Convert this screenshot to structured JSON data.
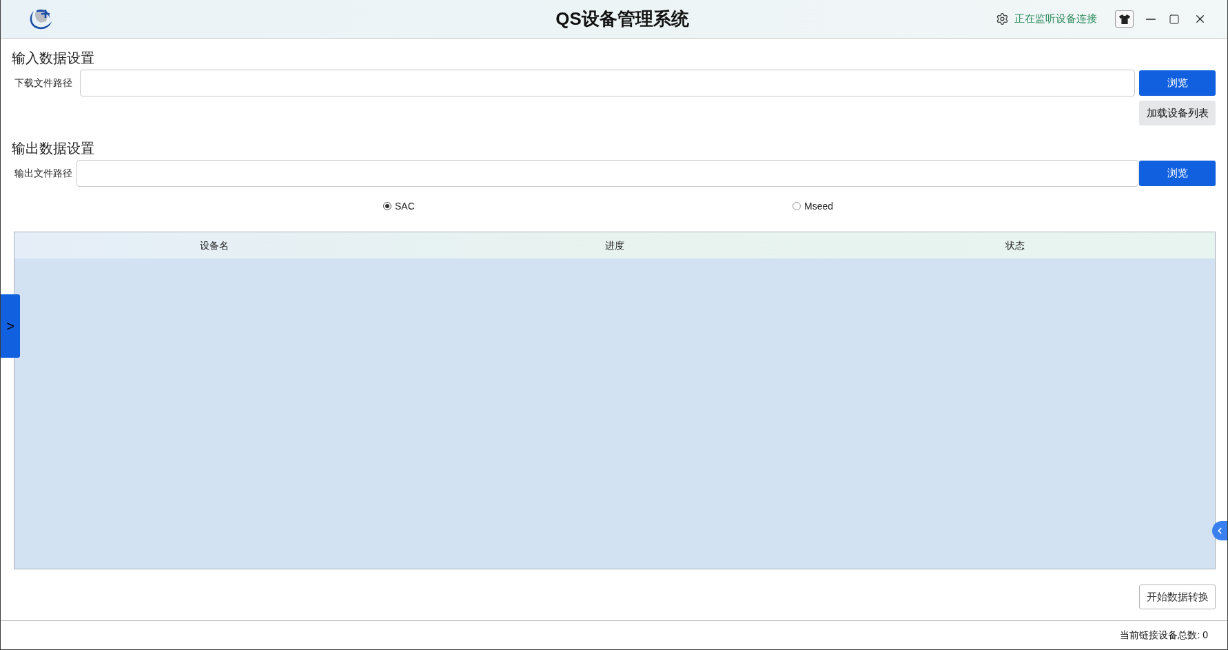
{
  "window": {
    "title": "QS设备管理系统",
    "status": "正在监听设备连接"
  },
  "input_settings": {
    "heading": "输入数据设置",
    "path_label": "下载文件路径",
    "browse_button": "浏览",
    "load_button": "加载设备列表"
  },
  "output_settings": {
    "heading": "输出数据设置",
    "path_label": "输出文件路径",
    "browse_button": "浏览",
    "formats": [
      {
        "label": "SAC",
        "selected": true
      },
      {
        "label": "Mseed",
        "selected": false
      }
    ]
  },
  "table": {
    "columns": [
      "设备名",
      "进度",
      "状态"
    ]
  },
  "sidebar_toggle": {
    "label": ">"
  },
  "start_button": "开始数据转换",
  "status_bar": {
    "text": "当前链接设备总数: 0"
  }
}
